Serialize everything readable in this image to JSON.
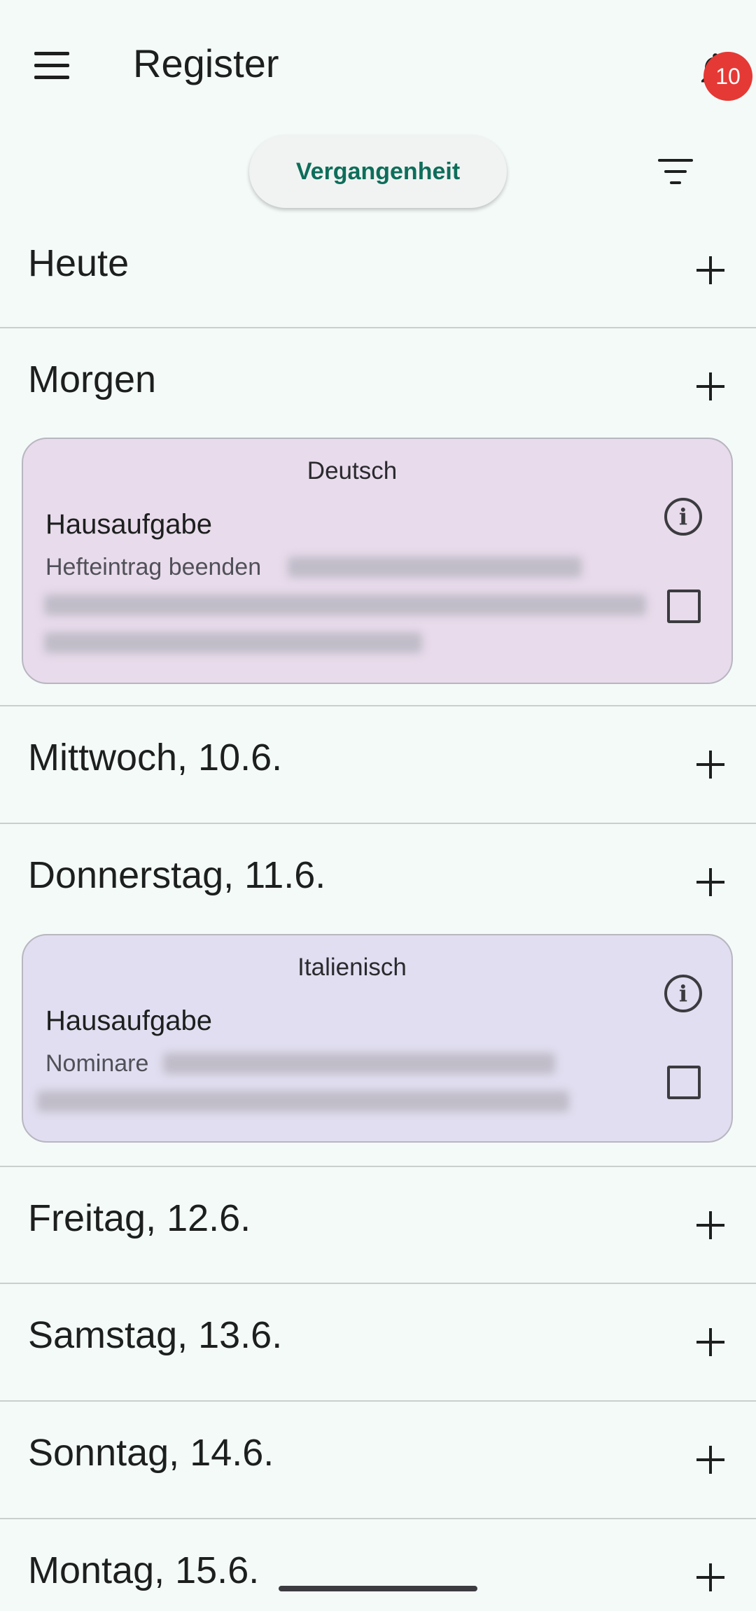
{
  "appbar": {
    "title": "Register",
    "notification_count": "10"
  },
  "toolbar": {
    "past_label": "Vergangenheit"
  },
  "days": [
    {
      "label": "Heute"
    },
    {
      "label": "Morgen"
    },
    {
      "label": "Mittwoch, 10.6."
    },
    {
      "label": "Donnerstag, 11.6."
    },
    {
      "label": "Freitag, 12.6."
    },
    {
      "label": "Samstag, 13.6."
    },
    {
      "label": "Sonntag, 14.6."
    },
    {
      "label": "Montag, 15.6."
    }
  ],
  "cards": [
    {
      "subject": "Deutsch",
      "type": "Hausaufgabe",
      "description": "Hefteintrag beenden",
      "color": "#e8dbeb",
      "completed": false
    },
    {
      "subject": "Italienisch",
      "type": "Hausaufgabe",
      "description": "Nominare",
      "color": "#e0def0",
      "completed": false
    }
  ],
  "colors": {
    "background": "#f4faf8",
    "accent": "#0d6e5a",
    "badge": "#e53935"
  },
  "icons": [
    "menu-icon",
    "bell-icon",
    "filter-icon",
    "plus-icon",
    "info-icon",
    "checkbox-icon"
  ]
}
